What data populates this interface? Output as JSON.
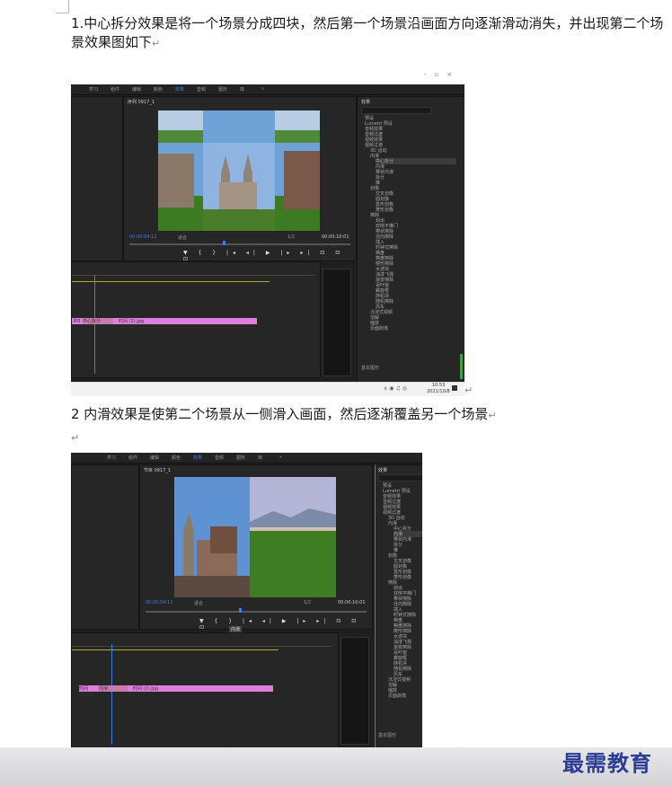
{
  "paragraphs": {
    "p1": "1.中心拆分效果是将一个场景分成四块，然后第一个场景沿画面方向逐渐滑动消失，并出现第二个场景效果图如下",
    "p2": "2 内滑效果是使第二个场景从一侧滑入画面，然后逐渐覆盖另一个场景",
    "return_mark": "↵"
  },
  "screenshot1": {
    "window_controls": [
      "-",
      "▫",
      "×"
    ],
    "menu": [
      "学习",
      "组件",
      "编辑",
      "颜色",
      "效果",
      "音频",
      "图形",
      "库",
      "»"
    ],
    "tab": "序列 0917_1",
    "effects_title": "效果",
    "timecode_left": "00:00:04:11",
    "fit_label": "适合",
    "ratio": "1/2",
    "timecode_right": "00:00:10:01",
    "clip_a": "中心拆分",
    "clip_b": "时间 (2).jpg",
    "clip_c": ".jpg",
    "effects": [
      "预设",
      "Lumetri 预设",
      "音频效果",
      "音频过渡",
      "视频效果",
      "视频过渡",
      "3D 运动",
      "内滑",
      "中心拆分",
      "内滑",
      "带状内滑",
      "拆分",
      "推",
      "划像",
      "交叉划像",
      "圆划像",
      "盒形划像",
      "菱形划像",
      "擦除",
      "划出",
      "双侧平推门",
      "带状擦除",
      "径向擦除",
      "插入",
      "时钟式擦除",
      "棋盘",
      "棋盘擦除",
      "楔形擦除",
      "水波块",
      "油漆飞溅",
      "渐变擦除",
      "百叶窗",
      "螺旋框",
      "随机块",
      "随机擦除",
      "风车",
      "沉浸式视频",
      "溶解",
      "缩放",
      "页面剥落"
    ],
    "basic": "基本图形",
    "clock": "10:53",
    "date": "2021/10/8"
  },
  "screenshot2": {
    "menu": [
      "学习",
      "组件",
      "编辑",
      "颜色",
      "效果",
      "音频",
      "图形",
      "库",
      "»"
    ],
    "tab": "节目 0917_1",
    "effects_title": "效果",
    "timecode_left": "00:00:04:11",
    "fit_label": "适合",
    "ratio": "1/2",
    "timecode_right": "00:00:10:01",
    "marker": "内滑",
    "clip_a": "时间 (1).jpg",
    "clip_b": "内滑",
    "clip_c": "时间 (2).jpg",
    "effects": [
      "预设",
      "Lumetri 预设",
      "音频效果",
      "音频过渡",
      "视频效果",
      "视频过渡",
      "3D 运动",
      "内滑",
      "中心拆分",
      "内滑",
      "带状内滑",
      "拆分",
      "推",
      "划像",
      "交叉划像",
      "圆划像",
      "盒形划像",
      "菱形划像",
      "擦除",
      "划出",
      "双侧平推门",
      "带状擦除",
      "径向擦除",
      "插入",
      "时钟式擦除",
      "棋盘",
      "棋盘擦除",
      "楔形擦除",
      "水波块",
      "油漆飞溅",
      "渐变擦除",
      "百叶窗",
      "螺旋框",
      "随机块",
      "随机擦除",
      "风车",
      "沉浸式视频",
      "溶解",
      "缩放",
      "页面剥落"
    ],
    "basic": "基本图形"
  },
  "watermark": "最需教育",
  "colors": {
    "clip": "#e07fdb",
    "accent": "#3a7ede",
    "watermark": "#2b3d96"
  }
}
